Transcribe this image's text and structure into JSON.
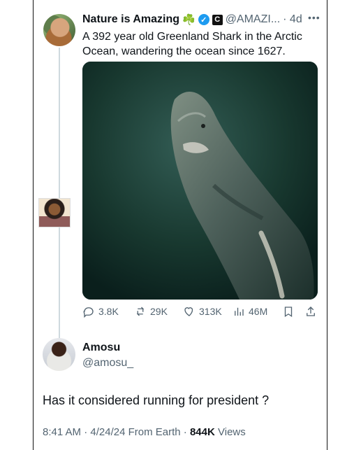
{
  "tweet": {
    "author_name": "Nature is Amazing",
    "badge_emoji": "☘️",
    "verified_mark": "✓",
    "affiliation_badge": "C",
    "handle": "@AMAZI...",
    "time": "· 4d",
    "text": "A 392 year old Greenland Shark in the Arctic Ocean, wandering the ocean since 1627.",
    "image_subject": "Greenland shark underwater",
    "counts": {
      "replies": "3.8K",
      "retweets": "29K",
      "likes": "313K",
      "views": "46M"
    }
  },
  "reply": {
    "author_name": "Amosu",
    "handle": "@amosu_",
    "text": "Has it considered running for president ?",
    "time": "8:41 AM",
    "date": "4/24/24",
    "source": "From Earth",
    "views_count": "844K",
    "views_label": "Views"
  },
  "colors": {
    "verified_blue": "#1d9bf0",
    "muted_text": "#536471",
    "thread_line": "#cfd9de"
  }
}
